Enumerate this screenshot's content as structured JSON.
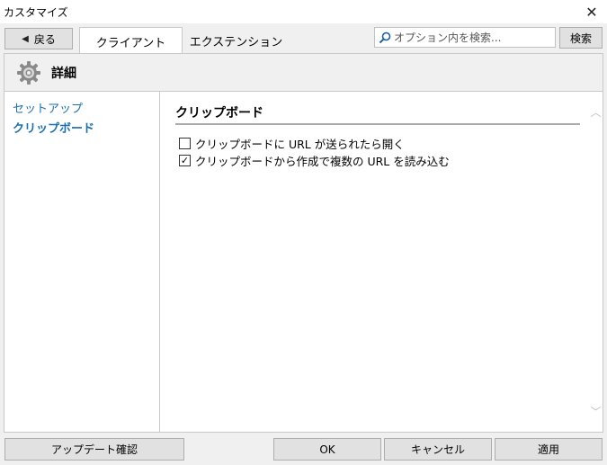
{
  "window": {
    "title": "カスタマイズ",
    "close_glyph": "✕"
  },
  "toolbar": {
    "back_label": "戻る",
    "tabs": [
      {
        "label": "クライアント",
        "active": true
      },
      {
        "label": "エクステンション",
        "active": false
      }
    ],
    "search_placeholder": "オプション内を検索...",
    "search_button": "検索"
  },
  "header": {
    "title": "詳細",
    "icon": "gear-icon"
  },
  "sidebar": {
    "items": [
      {
        "label": "セットアップ",
        "selected": false
      },
      {
        "label": "クリップボード",
        "selected": true
      }
    ]
  },
  "section": {
    "title": "クリップボード",
    "options": [
      {
        "label": "クリップボードに URL が送られたら開く",
        "checked": false
      },
      {
        "label": "クリップボードから作成で複数の URL を読み込む",
        "checked": true
      }
    ]
  },
  "footer": {
    "update_check": "アップデート確認",
    "ok": "OK",
    "cancel": "キャンセル",
    "apply": "適用"
  },
  "colors": {
    "link": "#1a6fb0",
    "button_bg": "#e1e1e1",
    "border": "#adadad"
  }
}
